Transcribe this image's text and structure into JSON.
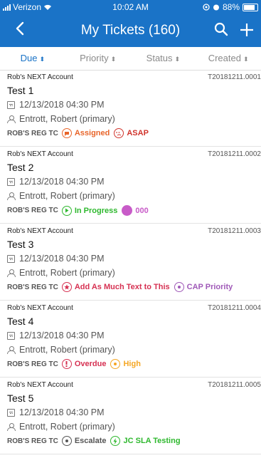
{
  "status_bar": {
    "carrier": "Verizon",
    "time": "10:02 AM",
    "battery": "88%"
  },
  "nav": {
    "title": "My Tickets (160)",
    "back_icon": "back-chevron",
    "search_icon": "search",
    "add_icon": "plus"
  },
  "sort": {
    "items": [
      {
        "label": "Due",
        "active": true
      },
      {
        "label": "Priority",
        "active": false
      },
      {
        "label": "Status",
        "active": false
      },
      {
        "label": "Created",
        "active": false
      }
    ]
  },
  "colors": {
    "primary": "#1a73c7",
    "assigned": "#e8652a",
    "asap": "#d0342c",
    "in_progress": "#2eb82e",
    "purple": "#c85bc8",
    "crimson": "#d63152",
    "cap_priority": "#a05ab8",
    "overdue": "#d63152",
    "high": "#f5a623",
    "escalate": "#555555",
    "jc_sla": "#2eb82e"
  },
  "tickets": [
    {
      "account": "Rob's NEXT Account",
      "id": "T20181211.0001",
      "name": "Test 1",
      "date": "12/13/2018 04:30 PM",
      "owner": "Entrott, Robert (primary)",
      "queue": "ROB'S REG TC",
      "status": {
        "label": "Assigned",
        "icon": "chat-bubble"
      },
      "priority": {
        "label": "ASAP",
        "icon": "dizzy-face"
      }
    },
    {
      "account": "Rob's NEXT Account",
      "id": "T20181211.0002",
      "name": "Test 2",
      "date": "12/13/2018 04:30 PM",
      "owner": "Entrott, Robert (primary)",
      "queue": "ROB'S REG TC",
      "status": {
        "label": "In Progress",
        "icon": "play"
      },
      "priority": {
        "label": "000",
        "icon": "purple-dot"
      }
    },
    {
      "account": "Rob's NEXT Account",
      "id": "T20181211.0003",
      "name": "Test 3",
      "date": "12/13/2018 04:30 PM",
      "owner": "Entrott, Robert (primary)",
      "queue": "ROB'S REG TC",
      "status": {
        "label": "Add As Much Text to This",
        "icon": "star"
      },
      "priority": {
        "label": "CAP Priority",
        "icon": "circle-dot"
      }
    },
    {
      "account": "Rob's NEXT Account",
      "id": "T20181211.0004",
      "name": "Test 4",
      "date": "12/13/2018 04:30 PM",
      "owner": "Entrott, Robert (primary)",
      "queue": "ROB'S REG TC",
      "status": {
        "label": "Overdue",
        "icon": "exclamation"
      },
      "priority": {
        "label": "High",
        "icon": "circle-dot"
      }
    },
    {
      "account": "Rob's NEXT Account",
      "id": "T20181211.0005",
      "name": "Test 5",
      "date": "12/13/2018 04:30 PM",
      "owner": "Entrott, Robert (primary)",
      "queue": "ROB'S REG TC",
      "status": {
        "label": "Escalate",
        "icon": "circle-dot"
      },
      "priority": {
        "label": "JC SLA Testing",
        "icon": "lightning"
      }
    }
  ]
}
